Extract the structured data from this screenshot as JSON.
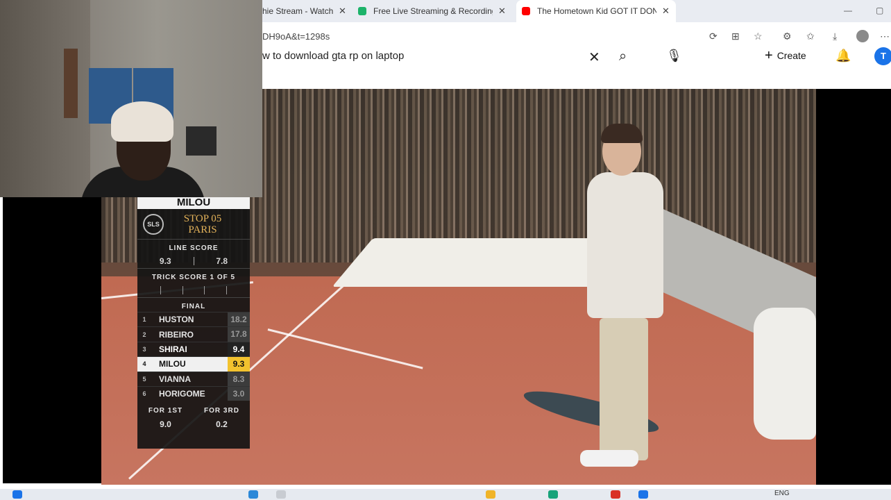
{
  "browser": {
    "tabs": [
      {
        "label": "hie Stream - Watch I",
        "active": false
      },
      {
        "label": "Free Live Streaming & Recording",
        "active": false
      },
      {
        "label": "The Hometown Kid GOT IT DONE",
        "active": true
      }
    ],
    "url": "DH9oA&t=1298s"
  },
  "youtube": {
    "search_query": "w to download gta rp on laptop",
    "create_label": "Create",
    "avatar_letter": "T"
  },
  "scoreboard": {
    "skater_name": "MILOU",
    "sls_logo": "SLS",
    "stop_line1": "STOP 05",
    "stop_line2": "PARIS",
    "line_score_label": "LINE SCORE",
    "line_scores": [
      "9.3",
      "7.8"
    ],
    "trick_score_label": "TRICK SCORE 1 OF 5",
    "final_label": "FINAL",
    "rankings": [
      {
        "pos": "1",
        "name": "HUSTON",
        "score": "18.2"
      },
      {
        "pos": "2",
        "name": "RIBEIRO",
        "score": "17.8"
      },
      {
        "pos": "3",
        "name": "SHIRAI",
        "score": "9.4"
      },
      {
        "pos": "4",
        "name": "MILOU",
        "score": "9.3"
      },
      {
        "pos": "5",
        "name": "VIANNA",
        "score": "8.3"
      },
      {
        "pos": "6",
        "name": "HORIGOME",
        "score": "3.0"
      }
    ],
    "for_1st_label": "FOR 1ST",
    "for_3rd_label": "FOR 3RD",
    "for_1st_value": "9.0",
    "for_3rd_value": "0.2"
  },
  "taskbar": {
    "language": "ENG"
  }
}
